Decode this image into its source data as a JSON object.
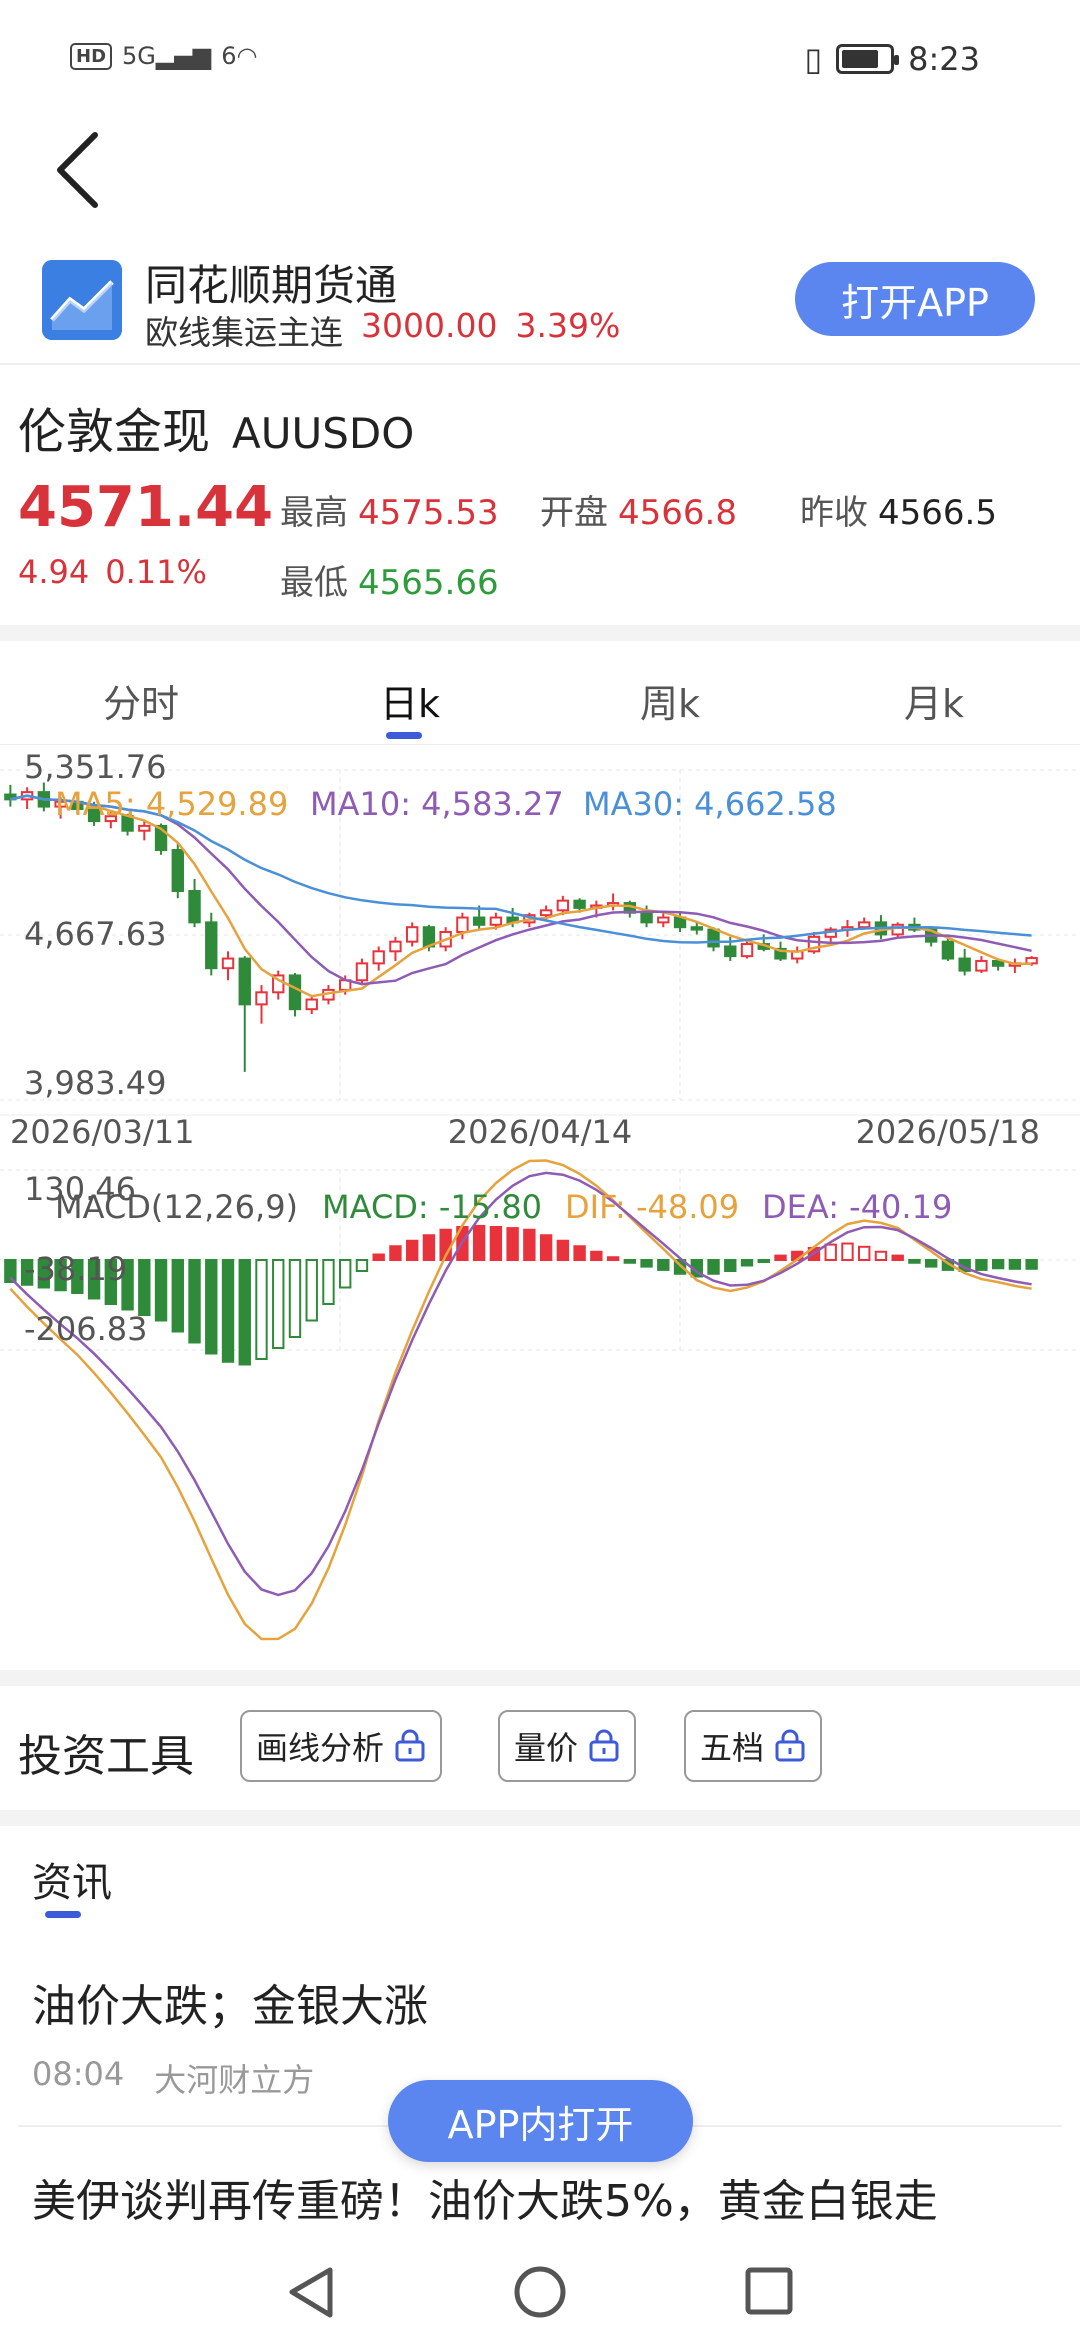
{
  "status": {
    "network": "HD",
    "signal1": "5G",
    "signal2": "6",
    "time": "8:23",
    "battery_level": 0.78
  },
  "banner": {
    "app_name": "同花顺期货通",
    "instrument": "欧线集运主连",
    "price": "3000.00",
    "change": "3.39%",
    "open_label": "打开APP"
  },
  "quote": {
    "name": "伦敦金现",
    "code": "AUUSDO",
    "price": "4571.44",
    "change": "4.94",
    "change_pct": "0.11%",
    "high_label": "最高",
    "high": "4575.53",
    "open_label": "开盘",
    "open": "4566.8",
    "prev_label": "昨收",
    "prev": "4566.5",
    "low_label": "最低",
    "low": "4565.66"
  },
  "tabs": [
    "分时",
    "日k",
    "周k",
    "月k"
  ],
  "active_tab": "日k",
  "chart_data": {
    "type": "candlestick",
    "y_max_label": "5,351.76",
    "y_mid_label": "4,667.63",
    "y_min_label": "3,983.49",
    "ylim": [
      3983.49,
      5351.76
    ],
    "dates": [
      "2026/03/11",
      "2026/04/14",
      "2026/05/18"
    ],
    "ma": [
      {
        "name": "MA5",
        "value": "4,529.89",
        "color": "#e6a23c"
      },
      {
        "name": "MA10",
        "value": "4,583.27",
        "color": "#8e5bb5"
      },
      {
        "name": "MA30",
        "value": "4,662.58",
        "color": "#4a90d9"
      }
    ],
    "macd": {
      "title": "MACD(12,26,9)",
      "macd_label": "MACD: -15.80",
      "dif_label": "DIF: -48.09",
      "dea_label": "DEA: -40.19",
      "y_max_label": "130.46",
      "y_mid_label": "-38.19",
      "y_min_label": "-206.83",
      "ylim": [
        -206.83,
        130.46
      ]
    },
    "candles": [
      [
        5250,
        5290,
        5200,
        5230
      ],
      [
        5230,
        5280,
        5190,
        5260
      ],
      [
        5260,
        5300,
        5180,
        5200
      ],
      [
        5200,
        5240,
        5150,
        5220
      ],
      [
        5220,
        5260,
        5170,
        5190
      ],
      [
        5190,
        5220,
        5120,
        5140
      ],
      [
        5140,
        5180,
        5110,
        5160
      ],
      [
        5160,
        5170,
        5080,
        5100
      ],
      [
        5100,
        5140,
        5060,
        5120
      ],
      [
        5120,
        5130,
        5000,
        5020
      ],
      [
        5020,
        5050,
        4820,
        4850
      ],
      [
        4850,
        4900,
        4700,
        4720
      ],
      [
        4720,
        4760,
        4500,
        4530
      ],
      [
        4530,
        4600,
        4480,
        4570
      ],
      [
        4570,
        4580,
        4100,
        4380
      ],
      [
        4380,
        4460,
        4300,
        4430
      ],
      [
        4430,
        4520,
        4400,
        4500
      ],
      [
        4500,
        4510,
        4330,
        4360
      ],
      [
        4360,
        4420,
        4340,
        4400
      ],
      [
        4400,
        4460,
        4380,
        4440
      ],
      [
        4440,
        4500,
        4420,
        4480
      ],
      [
        4480,
        4570,
        4460,
        4550
      ],
      [
        4550,
        4620,
        4520,
        4600
      ],
      [
        4600,
        4660,
        4560,
        4640
      ],
      [
        4640,
        4720,
        4620,
        4700
      ],
      [
        4700,
        4710,
        4600,
        4620
      ],
      [
        4620,
        4700,
        4600,
        4680
      ],
      [
        4680,
        4760,
        4650,
        4740
      ],
      [
        4740,
        4790,
        4690,
        4710
      ],
      [
        4710,
        4760,
        4690,
        4740
      ],
      [
        4740,
        4780,
        4700,
        4720
      ],
      [
        4720,
        4760,
        4700,
        4750
      ],
      [
        4750,
        4790,
        4730,
        4770
      ],
      [
        4770,
        4830,
        4750,
        4810
      ],
      [
        4810,
        4820,
        4760,
        4780
      ],
      [
        4780,
        4810,
        4740,
        4790
      ],
      [
        4790,
        4840,
        4770,
        4800
      ],
      [
        4800,
        4810,
        4740,
        4760
      ],
      [
        4760,
        4790,
        4700,
        4720
      ],
      [
        4720,
        4760,
        4700,
        4740
      ],
      [
        4740,
        4760,
        4680,
        4700
      ],
      [
        4700,
        4720,
        4670,
        4690
      ],
      [
        4690,
        4700,
        4600,
        4620
      ],
      [
        4620,
        4660,
        4560,
        4580
      ],
      [
        4580,
        4650,
        4570,
        4630
      ],
      [
        4630,
        4670,
        4600,
        4610
      ],
      [
        4610,
        4640,
        4560,
        4570
      ],
      [
        4570,
        4620,
        4550,
        4600
      ],
      [
        4600,
        4680,
        4590,
        4660
      ],
      [
        4660,
        4700,
        4640,
        4690
      ],
      [
        4690,
        4730,
        4660,
        4700
      ],
      [
        4700,
        4740,
        4690,
        4720
      ],
      [
        4720,
        4750,
        4650,
        4670
      ],
      [
        4670,
        4720,
        4660,
        4710
      ],
      [
        4710,
        4740,
        4680,
        4690
      ],
      [
        4690,
        4700,
        4620,
        4640
      ],
      [
        4640,
        4660,
        4560,
        4570
      ],
      [
        4570,
        4610,
        4500,
        4520
      ],
      [
        4520,
        4580,
        4510,
        4560
      ],
      [
        4560,
        4570,
        4520,
        4540
      ],
      [
        4540,
        4570,
        4510,
        4550
      ],
      [
        4550,
        4580,
        4540,
        4572
      ]
    ],
    "macd_bars": [
      -40,
      -45,
      -50,
      -55,
      -60,
      -70,
      -80,
      -90,
      -100,
      -110,
      -130,
      -150,
      -170,
      -185,
      -190,
      -180,
      -160,
      -140,
      -110,
      -80,
      -50,
      -20,
      10,
      25,
      35,
      45,
      55,
      60,
      62,
      60,
      58,
      55,
      45,
      35,
      25,
      15,
      5,
      -5,
      -12,
      -18,
      -25,
      -30,
      -25,
      -20,
      -10,
      -2,
      8,
      15,
      22,
      28,
      30,
      24,
      15,
      8,
      -5,
      -12,
      -18,
      -20,
      -18,
      -15,
      -16,
      -16
    ]
  },
  "tools": {
    "title": "投资工具",
    "buttons": [
      "画线分析",
      "量价",
      "五档"
    ]
  },
  "news": {
    "tab": "资讯",
    "headline1": "油价大跌；金银大涨",
    "time1": "08:04",
    "source1": "大河财立方",
    "headline2": "美伊谈判再传重磅！油价大跌5%，黄金白银走",
    "float_button": "APP内打开"
  }
}
